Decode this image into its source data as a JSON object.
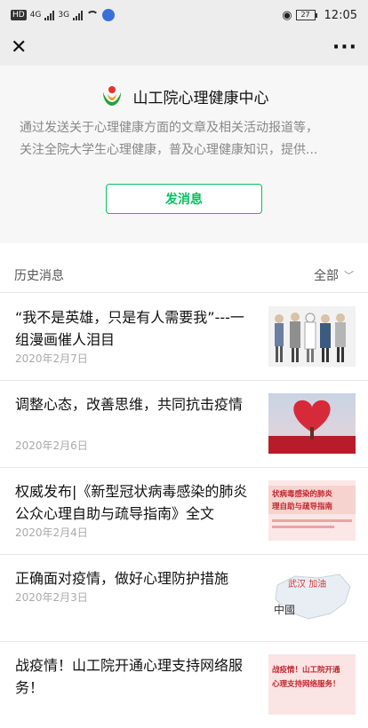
{
  "statusbar": {
    "carrier_badge": "HD",
    "net1": "4G",
    "net2": "3G",
    "battery": "27",
    "time": "12:05"
  },
  "navbar": {
    "close_icon": "close-icon",
    "more_icon": "more-icon",
    "close_glyph": "✕",
    "more_glyph": "···"
  },
  "profile": {
    "name": "山工院心理健康中心",
    "desc_line1": "通过发送关于心理健康方面的文章及相关活动报道等，",
    "desc_line2": "关注全院大学生心理健康，普及心理健康知识，提供...",
    "send_label": "发消息"
  },
  "history": {
    "title": "历史消息",
    "filter": "全部"
  },
  "articles": [
    {
      "title": "“我不是英雄，只是有人需要我”---一组漫画催人泪目",
      "date": "2020年2月7日"
    },
    {
      "title": "调整心态，改善思维，共同抗击疫情",
      "date": "2020年2月6日"
    },
    {
      "title": "权威发布|《新型冠状病毒感染的肺炎公众心理自助与疏导指南》全文",
      "date": "2020年2月4日"
    },
    {
      "title": "正确面对疫情，做好心理防护措施",
      "date": "2020年2月3日"
    },
    {
      "title": "战疫情！山工院开通心理支持网络服务！",
      "date": ""
    }
  ],
  "thumbs": {
    "t3_line1": "状病毒感染的肺炎",
    "t3_line2": "理自助与疏导指南",
    "t4_text1": "武汉 加油",
    "t4_text2": "中國",
    "t5_line1": "战疫情！山工院开通",
    "t5_line2": "心理支持网络服务！"
  },
  "colors": {
    "accent": "#07c160"
  }
}
